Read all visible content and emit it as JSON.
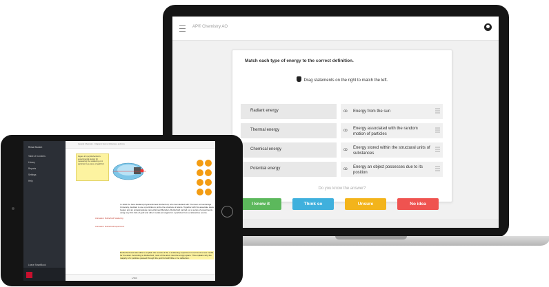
{
  "laptop": {
    "app_title": "AP® Chemistry AO",
    "question": "Match each type of energy to the correct definition.",
    "instruction": "Drag statements on the right to match the left.",
    "pairs": [
      {
        "term": "Radiant energy",
        "definition": "Energy from the sun"
      },
      {
        "term": "Thermal energy",
        "definition": "Energy associated with the random motion of particles"
      },
      {
        "term": "Chemical energy",
        "definition": "Energy stored within the structural units of substances"
      },
      {
        "term": "Potential energy",
        "definition": "Energy an object possesses due to its position"
      }
    ],
    "prompt": "Do you know the answer?",
    "buttons": [
      {
        "label": "I know it",
        "color": "#5cb85c"
      },
      {
        "label": "Think so",
        "color": "#3fb0dd"
      },
      {
        "label": "Unsure",
        "color": "#f3b41b"
      },
      {
        "label": "No idea",
        "color": "#ef5350"
      }
    ]
  },
  "tablet": {
    "sidebar_title": "Reina Student",
    "sidebar_items": [
      "Table of Contents",
      "Library",
      "Reports",
      "Settings",
      "Help"
    ],
    "sidebar_footer": "Leave SmartBook",
    "doc_breadcrumb": "General Chemistry · Chapter 2 Atoms, Molecules, and Ions",
    "figure_label": "Figure 2.6",
    "figure_caption": "Figure 2.6 (a) Rutherford's experimental design for measuring the scattering of α particles by a piece of gold foil.",
    "labels": [
      "Gold foil",
      "α-Particle emitter",
      "Slit",
      "Detecting screen"
    ],
    "annotations": [
      "Animation: Rutherford Scattering",
      "Animation: Rutherford Experiment"
    ],
    "paragraph1": "In 1910 the New Zealand physicist Ernest Rutherford, who had studied with Thomson at Cambridge University, decided to use α particles to probe the structure of atoms. Together with his associate Hans Geiger and an undergraduate named Ernest Marsden, Rutherford carried out a series of experiments using very thin foils of gold and other metals as targets for α particles from a radioactive source.",
    "paragraph2": "Rutherford was later able to explain the results of the α-scattering experiment in terms of a new model for the atom. According to Rutherford, most of the atom must be empty space. This explains why the majority of α particles passed through the gold foil with little or no deflection.",
    "footer_page": "1/390"
  }
}
